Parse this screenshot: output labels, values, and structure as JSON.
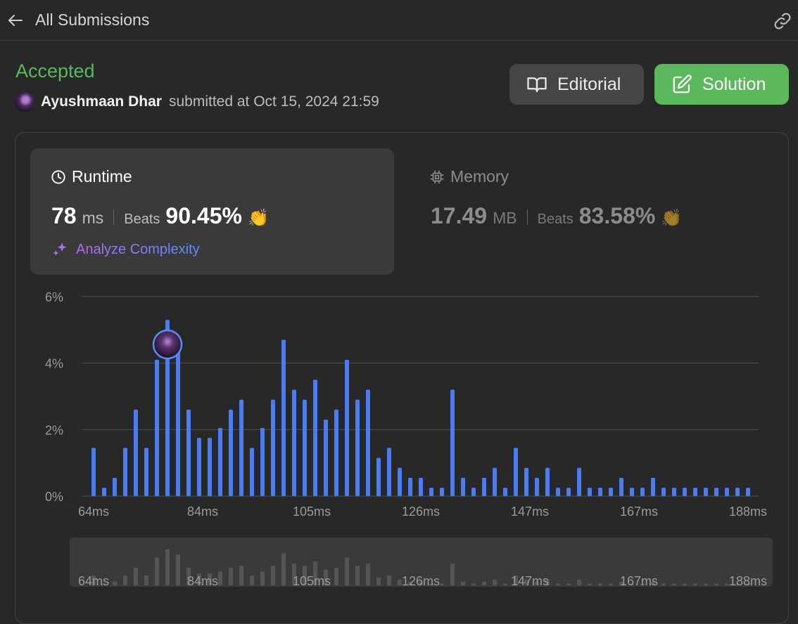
{
  "header": {
    "title": "All Submissions",
    "back_icon": "arrow-left-icon",
    "link_icon": "link-icon"
  },
  "submission": {
    "status": "Accepted",
    "status_color": "#5cb85c",
    "author": "Ayushmaan Dhar",
    "submitted_text": "submitted at Oct 15, 2024 21:59"
  },
  "buttons": {
    "editorial": "Editorial",
    "solution": "Solution"
  },
  "runtime": {
    "title": "Runtime",
    "value": "78",
    "unit": "ms",
    "beats_label": "Beats",
    "beats_pct": "90.45%",
    "analyze_label": "Analyze Complexity"
  },
  "memory": {
    "title": "Memory",
    "value": "17.49",
    "unit": "MB",
    "beats_label": "Beats",
    "beats_pct": "83.58%"
  },
  "chart_data": {
    "type": "bar",
    "ylabel": "",
    "xlabel": "",
    "ylim": [
      0,
      6
    ],
    "yticks": [
      "0%",
      "2%",
      "4%",
      "6%"
    ],
    "xtick_labels": [
      "64ms",
      "84ms",
      "105ms",
      "126ms",
      "147ms",
      "167ms",
      "188ms"
    ],
    "bar_color": "#4a7cf6",
    "highlight_index": 7,
    "values": [
      1.45,
      0.25,
      0.55,
      1.45,
      2.6,
      1.45,
      4.1,
      5.3,
      4.5,
      2.6,
      1.75,
      1.75,
      2.05,
      2.6,
      2.9,
      1.45,
      2.05,
      2.9,
      4.7,
      3.2,
      2.9,
      3.5,
      2.3,
      2.6,
      4.1,
      2.9,
      3.2,
      1.15,
      1.45,
      0.85,
      0.55,
      0.55,
      0.25,
      0.25,
      3.2,
      0.55,
      0.25,
      0.55,
      0.85,
      0.25,
      1.45,
      0.85,
      0.55,
      0.85,
      0.25,
      0.25,
      0.85,
      0.25,
      0.25,
      0.25,
      0.55,
      0.25,
      0.25,
      0.55,
      0.25,
      0.25,
      0.25,
      0.25,
      0.25,
      0.25,
      0.25,
      0.25,
      0.25
    ]
  }
}
